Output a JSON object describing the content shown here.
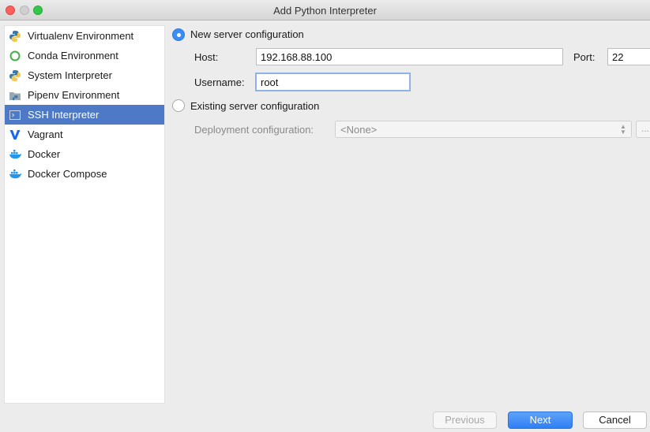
{
  "window": {
    "title": "Add Python Interpreter"
  },
  "sidebar": {
    "items": [
      {
        "label": "Virtualenv Environment",
        "icon": "python-icon"
      },
      {
        "label": "Conda Environment",
        "icon": "conda-icon"
      },
      {
        "label": "System Interpreter",
        "icon": "python-icon"
      },
      {
        "label": "Pipenv Environment",
        "icon": "pipenv-icon"
      },
      {
        "label": "SSH Interpreter",
        "icon": "ssh-icon",
        "selected": true
      },
      {
        "label": "Vagrant",
        "icon": "vagrant-icon"
      },
      {
        "label": "Docker",
        "icon": "docker-icon"
      },
      {
        "label": "Docker Compose",
        "icon": "docker-icon"
      }
    ]
  },
  "main": {
    "new_server_label": "New server configuration",
    "host_label": "Host:",
    "host_value": "192.168.88.100",
    "port_label": "Port:",
    "port_value": "22",
    "username_label": "Username:",
    "username_value": "root",
    "existing_server_label": "Existing server configuration",
    "deployment_label": "Deployment configuration:",
    "deployment_value": "<None>",
    "browse_label": "..."
  },
  "footer": {
    "previous_label": "Previous",
    "next_label": "Next",
    "cancel_label": "Cancel"
  },
  "colors": {
    "selection": "#4d79c7",
    "accent_blue": "#3b8cf5"
  }
}
